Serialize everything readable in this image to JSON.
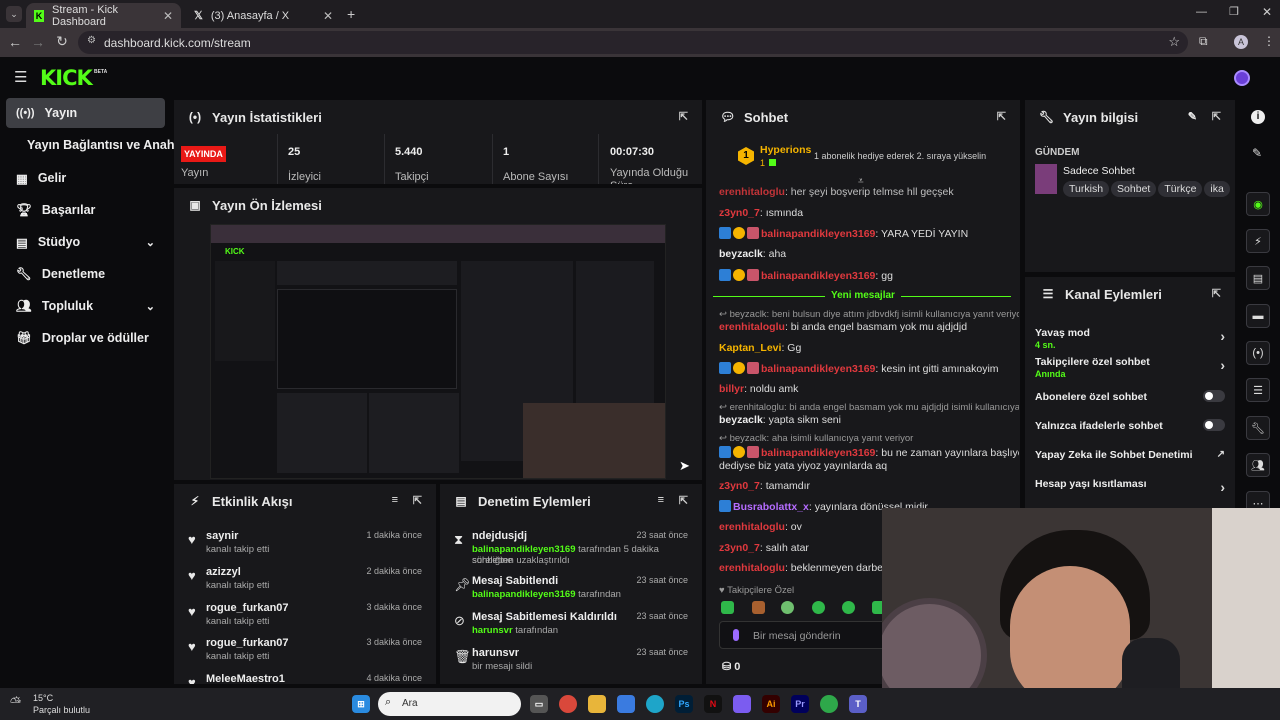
{
  "browser": {
    "tabs": [
      {
        "title": "Stream - Kick Dashboard"
      },
      {
        "title": "(3) Anasayfa / X"
      }
    ],
    "url": "dashboard.kick.com/stream",
    "profile_initial": "A"
  },
  "kick": {
    "logo": "KICK",
    "beta": "BETA"
  },
  "sidebar": {
    "items": [
      {
        "label": "Yayın"
      },
      {
        "label": "Yayın Bağlantısı ve Anahtarı"
      },
      {
        "label": "Gelir"
      },
      {
        "label": "Başarılar"
      },
      {
        "label": "Stüdyo"
      },
      {
        "label": "Denetleme"
      },
      {
        "label": "Topluluk"
      },
      {
        "label": "Droplar ve ödüller"
      }
    ]
  },
  "stats": {
    "title": "Yayın İstatistikleri",
    "live_badge": "YAYINDA",
    "live_label": "Yayın",
    "items": [
      {
        "value": "25",
        "label": "İzleyici"
      },
      {
        "value": "5.440",
        "label": "Takipçi"
      },
      {
        "value": "1",
        "label": "Abone Sayısı"
      },
      {
        "value": "00:07:30",
        "label": "Yayında Olduğu Süre"
      }
    ]
  },
  "preview": {
    "title": "Yayın Ön İzlemesi"
  },
  "activity": {
    "title": "Etkinlik Akışı",
    "items": [
      {
        "name": "saynir",
        "text": "kanalı takip etti",
        "time": "1 dakika önce"
      },
      {
        "name": "azizzyl",
        "text": "kanalı takip etti",
        "time": "2 dakika önce"
      },
      {
        "name": "rogue_furkan07",
        "text": "kanalı takip etti",
        "time": "3 dakika önce"
      },
      {
        "name": "rogue_furkan07",
        "text": "kanalı takip etti",
        "time": "3 dakika önce"
      },
      {
        "name": "MeleeMaestro1",
        "text": "",
        "time": "4 dakika önce"
      }
    ]
  },
  "moderation": {
    "title": "Denetim Eylemleri",
    "items": [
      {
        "title": "ndejdusjdj",
        "user": "balinapandikleyen3169",
        "text": "tarafından 5 dakika süreliğine",
        "text2": "sohbetten uzaklaştırıldı",
        "time": "23 saat önce"
      },
      {
        "title": "Mesaj Sabitlendi",
        "user": "balinapandikleyen3169",
        "text": "tarafından",
        "time": "23 saat önce"
      },
      {
        "title": "Mesaj Sabitlemesi Kaldırıldı",
        "user": "harunsvr",
        "text": "tarafından",
        "time": "23 saat önce"
      },
      {
        "title": "harunsvr",
        "user": "",
        "text": "bir mesajı sildi",
        "time": "23 saat önce"
      }
    ]
  },
  "chat": {
    "title": "Sohbet",
    "pinned_user": "Hyperions",
    "pinned_rank": "1",
    "pinned_count": "1",
    "pinned_text": "1 abonelik hediye ederek 2. sıraya yükselin",
    "new_messages": "Yeni mesajlar",
    "messages": [
      {
        "user": "erenhitaloglu",
        "text": ": her şeyi boşverip telmse hll geçşek",
        "style": "red"
      },
      {
        "user": "z3yn0_7",
        "text": ": ısmında",
        "style": "red"
      },
      {
        "user": "balinapandikleyen3169",
        "text": ": YARA YEDİ YAYIN",
        "style": "red",
        "badges": true
      },
      {
        "user": "beyzaclk",
        "text": ": aha",
        "style": "w"
      },
      {
        "user": "balinapandikleyen3169",
        "text": ": gg",
        "style": "red",
        "badges": true
      },
      {
        "reply": "↩ beyzaclk: beni bulsun diye attım jdbvdkfj isimli kullanıcıya yanıt veriyor",
        "user": "erenhitaloglu",
        "text": ": bi anda engel basmam yok mu ajdjdjd",
        "style": "red"
      },
      {
        "user": "Kaptan_Levi",
        "text": ": Gg",
        "style": "y"
      },
      {
        "user": "balinapandikleyen3169",
        "text": ": kesin int gitti amınakoyim",
        "style": "red",
        "badges": true
      },
      {
        "user": "billyr",
        "text": ": noldu amk",
        "style": "red"
      },
      {
        "reply": "↩ erenhitaloglu: bi anda engel basmam yok mu ajdjdjd isimli kullanıcıya ...",
        "user": "beyzaclk",
        "text": ": yapta sikm seni",
        "style": "w"
      },
      {
        "reply": "↩ beyzaclk: aha isimli kullanıcıya yanıt veriyor",
        "user": "balinapandikleyen3169",
        "text": ": bu ne zaman yayınlara başlıycam",
        "text2": "dediyse biz yata yiyoz yayınlarda aq",
        "style": "red",
        "badges": true
      },
      {
        "user": "z3yn0_7",
        "text": ": tamamdır",
        "style": "red"
      },
      {
        "user": "Busrabolattx_x",
        "text": ": yayınlara dönüşsel midir",
        "style": "p",
        "badges": true
      },
      {
        "user": "erenhitaloglu",
        "text": ": ov",
        "style": "red"
      },
      {
        "user": "z3yn0_7",
        "text": ": salıh atar",
        "style": "red"
      },
      {
        "user": "erenhitaloglu",
        "text": ": beklenmeyen darbe",
        "style": "red"
      }
    ],
    "followers_only": "Takipçilere Özel",
    "input_placeholder": "Bir mesaj gönderin",
    "points": "0"
  },
  "stream_info": {
    "title": "Yayın bilgisi",
    "section": "GÜNDEM",
    "category": "Sadece Sohbet",
    "tags": [
      "Turkish",
      "Sohbet",
      "Türkçe",
      "ika"
    ]
  },
  "channel_actions": {
    "title": "Kanal Eylemleri",
    "items": [
      {
        "label": "Yavaş mod",
        "sub": "4 sn.",
        "control": "arrow"
      },
      {
        "label": "Takipçilere özel sohbet",
        "sub": "Anında",
        "control": "arrow"
      },
      {
        "label": "Abonelere özel sohbet",
        "sub": "",
        "control": "toggle"
      },
      {
        "label": "Yalnızca ifadelerle sohbet",
        "sub": "",
        "control": "toggle"
      },
      {
        "label": "Yapay Zeka ile Sohbet Denetimi",
        "sub": "",
        "control": "link"
      },
      {
        "label": "Hesap yaşı kısıtlaması",
        "sub": "",
        "control": "arrow"
      }
    ]
  },
  "taskbar": {
    "temp": "15°C",
    "weather": "Parçalı bulutlu",
    "search": "Ara"
  },
  "colors": {
    "accent": "#53fc18",
    "live": "#e91916",
    "panel": "#18181b"
  }
}
